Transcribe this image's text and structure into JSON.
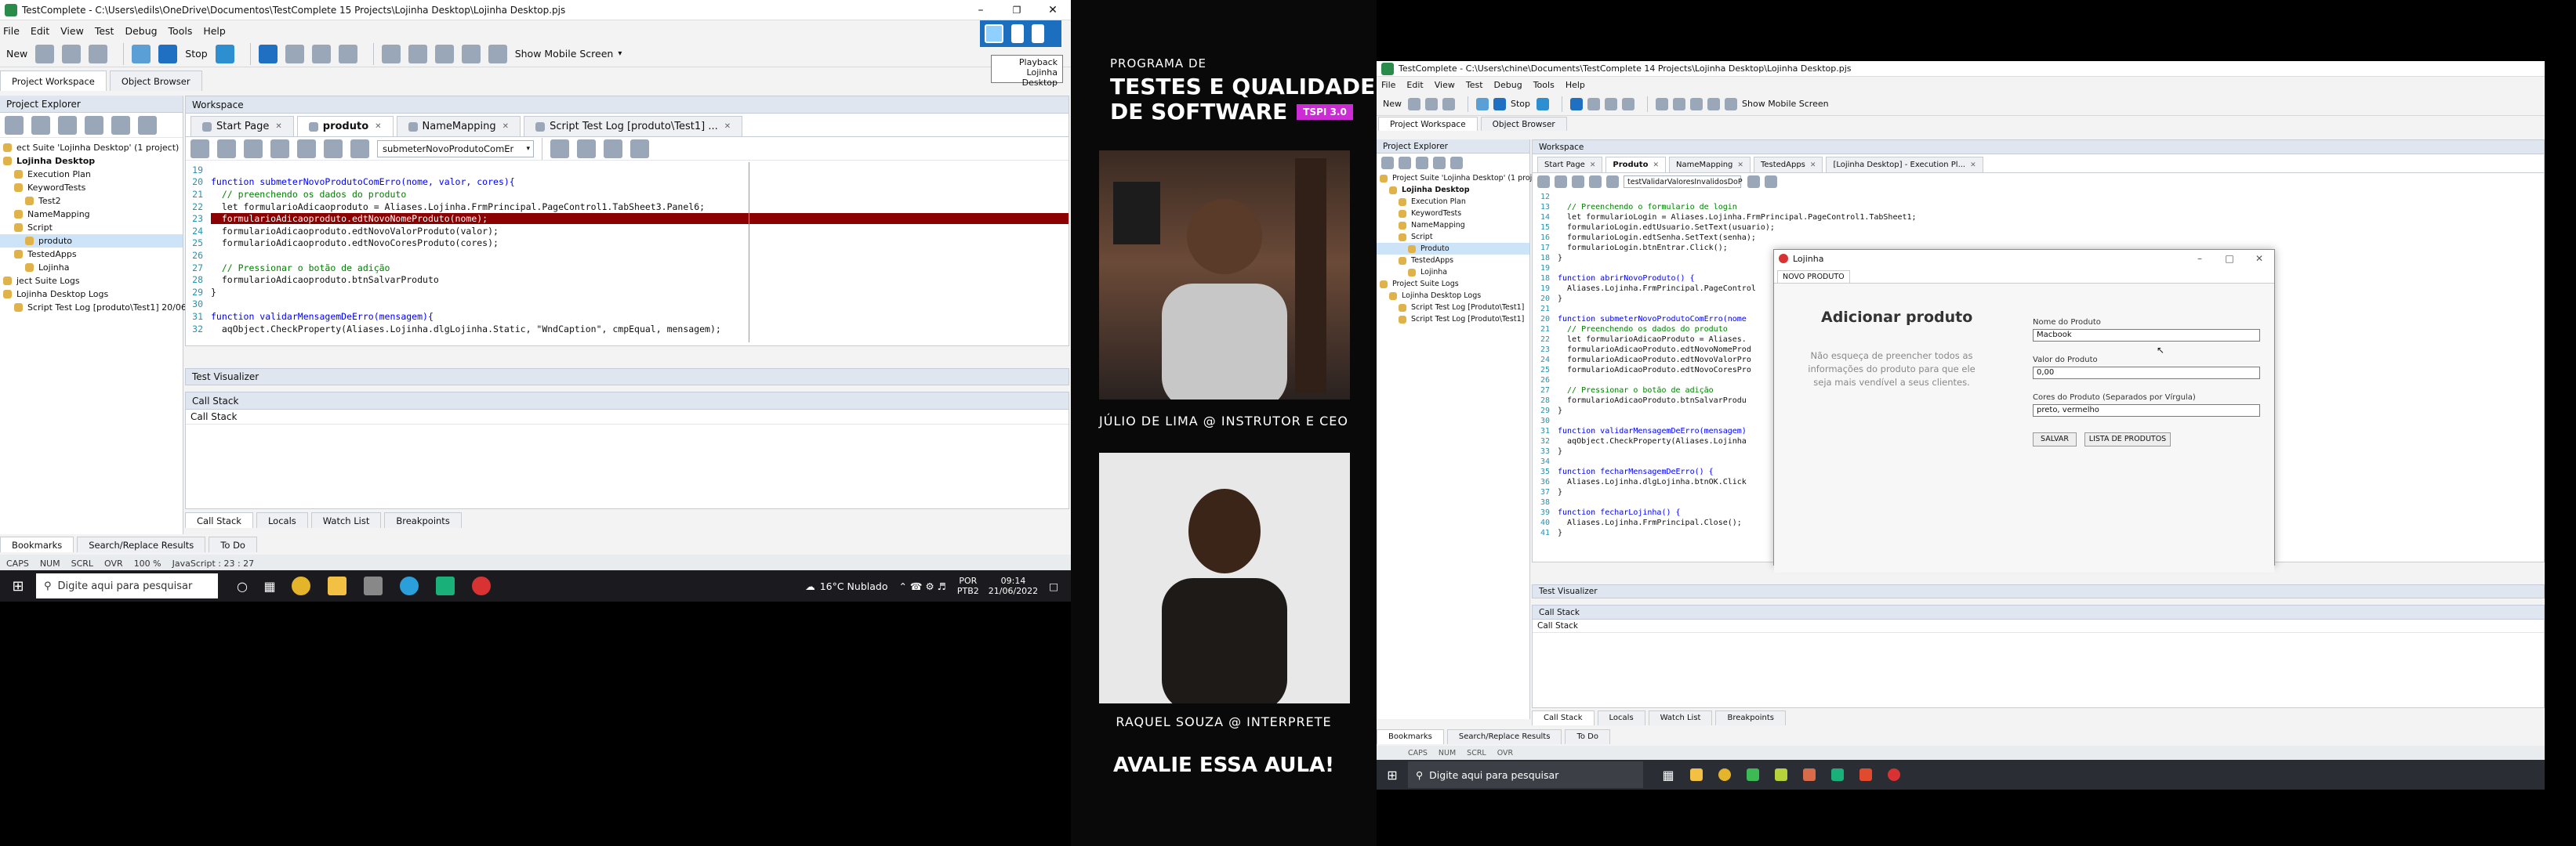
{
  "left_window": {
    "title": "TestComplete - C:\\Users\\edils\\OneDrive\\Documentos\\TestComplete 15 Projects\\Lojinha Desktop\\Lojinha Desktop.pjs",
    "menu": [
      "File",
      "Edit",
      "View",
      "Test",
      "Debug",
      "Tools",
      "Help"
    ],
    "toolbar": {
      "new": "New",
      "stop": "Stop",
      "mobile": "Show Mobile Screen"
    },
    "playback_tooltip": [
      "Playback",
      "Lojinha Desktop"
    ],
    "workspace_tabs": [
      "Project Workspace",
      "Object Browser"
    ],
    "project_explorer_title": "Project Explorer",
    "tree": [
      {
        "label": "ect Suite 'Lojinha Desktop' (1 project)",
        "bold": false,
        "indent": 0
      },
      {
        "label": "Lojinha Desktop",
        "bold": true,
        "indent": 0
      },
      {
        "label": "Execution Plan",
        "bold": false,
        "indent": 1
      },
      {
        "label": "KeywordTests",
        "bold": false,
        "indent": 1
      },
      {
        "label": "Test2",
        "bold": false,
        "indent": 2
      },
      {
        "label": "NameMapping",
        "bold": false,
        "indent": 1
      },
      {
        "label": "Script",
        "bold": false,
        "indent": 1
      },
      {
        "label": "produto",
        "bold": false,
        "indent": 2,
        "selected": true
      },
      {
        "label": "TestedApps",
        "bold": false,
        "indent": 1
      },
      {
        "label": "Lojinha",
        "bold": false,
        "indent": 2
      },
      {
        "label": "ject Suite Logs",
        "bold": false,
        "indent": 0
      },
      {
        "label": "Lojinha Desktop Logs",
        "bold": false,
        "indent": 0
      },
      {
        "label": "Script Test Log [produto\\Test1] 20/06/2022",
        "bold": false,
        "indent": 1
      }
    ],
    "workspace_title": "Workspace",
    "editor_tabs": [
      {
        "label": "Start Page",
        "active": false
      },
      {
        "label": "produto",
        "active": true
      },
      {
        "label": "NameMapping",
        "active": false
      },
      {
        "label": "Script Test Log [produto\\Test1] ...",
        "active": false
      }
    ],
    "function_dropdown": "submeterNovoProdutoComEr",
    "code_lines": [
      {
        "n": "19",
        "t": "",
        "kind": "plain"
      },
      {
        "n": "20",
        "t": "function submeterNovoProdutoComErro(nome, valor, cores){",
        "kind": "fn"
      },
      {
        "n": "21",
        "t": "  // preenchendo os dados do produto",
        "kind": "comment"
      },
      {
        "n": "22",
        "t": "  let formularioAdicaoproduto = Aliases.Lojinha.FrmPrincipal.PageControl1.TabSheet3.Panel6;",
        "kind": "plain"
      },
      {
        "n": "23",
        "t": "  formularioAdicaoproduto.edtNovoNomeProduto(nome);",
        "kind": "hl"
      },
      {
        "n": "24",
        "t": "  formularioAdicaoproduto.edtNovoValorProduto(valor);",
        "kind": "plain"
      },
      {
        "n": "25",
        "t": "  formularioAdicaoproduto.edtNovoCoresProduto(cores);",
        "kind": "plain"
      },
      {
        "n": "26",
        "t": "",
        "kind": "plain"
      },
      {
        "n": "27",
        "t": "  // Pressionar o botão de adição",
        "kind": "comment"
      },
      {
        "n": "28",
        "t": "  formularioAdicaoproduto.btnSalvarProduto",
        "kind": "plain"
      },
      {
        "n": "29",
        "t": "}",
        "kind": "plain"
      },
      {
        "n": "30",
        "t": "",
        "kind": "plain"
      },
      {
        "n": "31",
        "t": "function validarMensagemDeErro(mensagem){",
        "kind": "fn"
      },
      {
        "n": "32",
        "t": "  aqObject.CheckProperty(Aliases.Lojinha.dlgLojinha.Static, \"WndCaption\", cmpEqual, mensagem);",
        "kind": "plain"
      }
    ],
    "test_visualizer": "Test Visualizer",
    "call_stack_title": "Call Stack",
    "call_stack_column": "Call Stack",
    "bottom_tabs": [
      "Call Stack",
      "Locals",
      "Watch List",
      "Breakpoints"
    ],
    "bottom_tabs2": [
      "Bookmarks",
      "Search/Replace Results",
      "To Do"
    ],
    "status": [
      "CAPS",
      "NUM",
      "SCRL",
      "OVR",
      "100 %",
      "JavaScript : 23 : 27"
    ]
  },
  "taskbar": {
    "search_placeholder": "Digite aqui para pesquisar",
    "weather": "16°C  Nublado",
    "lang": "POR",
    "lang2": "PTB2",
    "time": "09:14",
    "date": "21/06/2022"
  },
  "course": {
    "subtitle": "PROGRAMA DE",
    "title1": "TESTES E QUALIDADE",
    "title2": "DE SOFTWARE",
    "badge": "TSPI 3.0",
    "instructor": "JÚLIO DE LIMA @ INSTRUTOR E CEO",
    "interpreter": "RAQUEL SOUZA @ INTERPRETE",
    "cta": "AVALIE ESSA AULA!",
    "accent": "#cc2bd6"
  },
  "right_window": {
    "title": "TestComplete - C:\\Users\\chine\\Documents\\TestComplete 14 Projects\\Lojinha Desktop\\Lojinha Desktop.pjs",
    "menu": [
      "File",
      "Edit",
      "View",
      "Test",
      "Debug",
      "Tools",
      "Help"
    ],
    "toolbar": {
      "new": "New",
      "stop": "Stop",
      "mobile": "Show Mobile Screen"
    },
    "workspace_tabs": [
      "Project Workspace",
      "Object Browser"
    ],
    "project_explorer_title": "Project Explorer",
    "tree": [
      {
        "label": "Project Suite 'Lojinha Desktop' (1 project)",
        "indent": 0
      },
      {
        "label": "Lojinha Desktop",
        "indent": 1,
        "bold": true
      },
      {
        "label": "Execution Plan",
        "indent": 2
      },
      {
        "label": "KeywordTests",
        "indent": 2
      },
      {
        "label": "NameMapping",
        "indent": 2
      },
      {
        "label": "Script",
        "indent": 2
      },
      {
        "label": "Produto",
        "indent": 3,
        "selected": true
      },
      {
        "label": "TestedApps",
        "indent": 2
      },
      {
        "label": "Lojinha",
        "indent": 3
      },
      {
        "label": "Project Suite Logs",
        "indent": 0
      },
      {
        "label": "Lojinha Desktop Logs",
        "indent": 1
      },
      {
        "label": "Script Test Log [Produto\\Test1]",
        "indent": 2
      },
      {
        "label": "Script Test Log [Produto\\Test1]",
        "indent": 2
      }
    ],
    "workspace_title": "Workspace",
    "editor_tabs": [
      "Start Page",
      "Produto",
      "NameMapping",
      "TestedApps",
      "[Lojinha Desktop] - Execution Pl..."
    ],
    "function_dropdown": "testValidarValoresInvalidosDoP",
    "code_lines": [
      {
        "n": "12",
        "t": ""
      },
      {
        "n": "13",
        "t": "  // Preenchendo o formulario de login",
        "kind": "comment"
      },
      {
        "n": "14",
        "t": "  let formularioLogin = Aliases.Lojinha.FrmPrincipal.PageControl1.TabSheet1;"
      },
      {
        "n": "15",
        "t": "  formularioLogin.edtUsuario.SetText(usuario);"
      },
      {
        "n": "16",
        "t": "  formularioLogin.edtSenha.SetText(senha);"
      },
      {
        "n": "17",
        "t": "  formularioLogin.btnEntrar.Click();"
      },
      {
        "n": "18",
        "t": "}"
      },
      {
        "n": "19",
        "t": ""
      },
      {
        "n": "18",
        "t": "function abrirNovoProduto() {",
        "kind": "fn"
      },
      {
        "n": "19",
        "t": "  Aliases.Lojinha.FrmPrincipal.PageControl"
      },
      {
        "n": "20",
        "t": "}"
      },
      {
        "n": "21",
        "t": ""
      },
      {
        "n": "20",
        "t": "function submeterNovoProdutoComErro(nome",
        "kind": "fn"
      },
      {
        "n": "21",
        "t": "  // Preenchendo os dados do produto",
        "kind": "comment"
      },
      {
        "n": "22",
        "t": "  let formularioAdicaoProduto = Aliases."
      },
      {
        "n": "23",
        "t": "  formularioAdicaoProduto.edtNovoNomeProd"
      },
      {
        "n": "24",
        "t": "  formularioAdicaoProduto.edtNovoValorPro"
      },
      {
        "n": "25",
        "t": "  formularioAdicaoProduto.edtNovoCoresPro"
      },
      {
        "n": "26",
        "t": ""
      },
      {
        "n": "27",
        "t": "  // Pressionar o botão de adição",
        "kind": "comment"
      },
      {
        "n": "28",
        "t": "  formularioAdicaoProduto.btnSalvarProdu"
      },
      {
        "n": "29",
        "t": "}"
      },
      {
        "n": "30",
        "t": ""
      },
      {
        "n": "31",
        "t": "function validarMensagemDeErro(mensagem)",
        "kind": "fn"
      },
      {
        "n": "32",
        "t": "  aqObject.CheckProperty(Aliases.Lojinha"
      },
      {
        "n": "33",
        "t": "}"
      },
      {
        "n": "34",
        "t": ""
      },
      {
        "n": "35",
        "t": "function fecharMensagemDeErro() {",
        "kind": "fn"
      },
      {
        "n": "36",
        "t": "  Aliases.Lojinha.dlgLojinha.btnOK.Click"
      },
      {
        "n": "37",
        "t": "}"
      },
      {
        "n": "38",
        "t": ""
      },
      {
        "n": "39",
        "t": "function fecharLojinha() {",
        "kind": "fn"
      },
      {
        "n": "40",
        "t": "  Aliases.Lojinha.FrmPrincipal.Close();"
      },
      {
        "n": "41",
        "t": "}"
      }
    ],
    "test_visualizer": "Test Visualizer",
    "call_stack_title": "Call Stack",
    "call_stack_column": "Call Stack",
    "bottom_tabs": [
      "Call Stack",
      "Locals",
      "Watch List",
      "Breakpoints"
    ],
    "bottom_tabs2": [
      "Bookmarks",
      "Search/Replace Results",
      "To Do"
    ],
    "status": [
      "CAPS",
      "NUM",
      "SCRL",
      "OVR"
    ]
  },
  "lojinha_dialog": {
    "title": "Lojinha",
    "tab": "NOVO PRODUTO",
    "heading": "Adicionar produto",
    "description": "Não esqueça de preencher todos as informações do produto para que ele seja mais vendível a seus clientes.",
    "name_label": "Nome do Produto",
    "name_value": "Macbook",
    "value_label": "Valor do Produto",
    "value_value": "0,00",
    "colors_label": "Cores do Produto (Separados por Vírgula)",
    "colors_value": "preto, vermelho",
    "save_button": "SALVAR",
    "list_button": "LISTA DE PRODUTOS"
  },
  "right_taskbar": {
    "search_placeholder": "Digite aqui para pesquisar"
  }
}
